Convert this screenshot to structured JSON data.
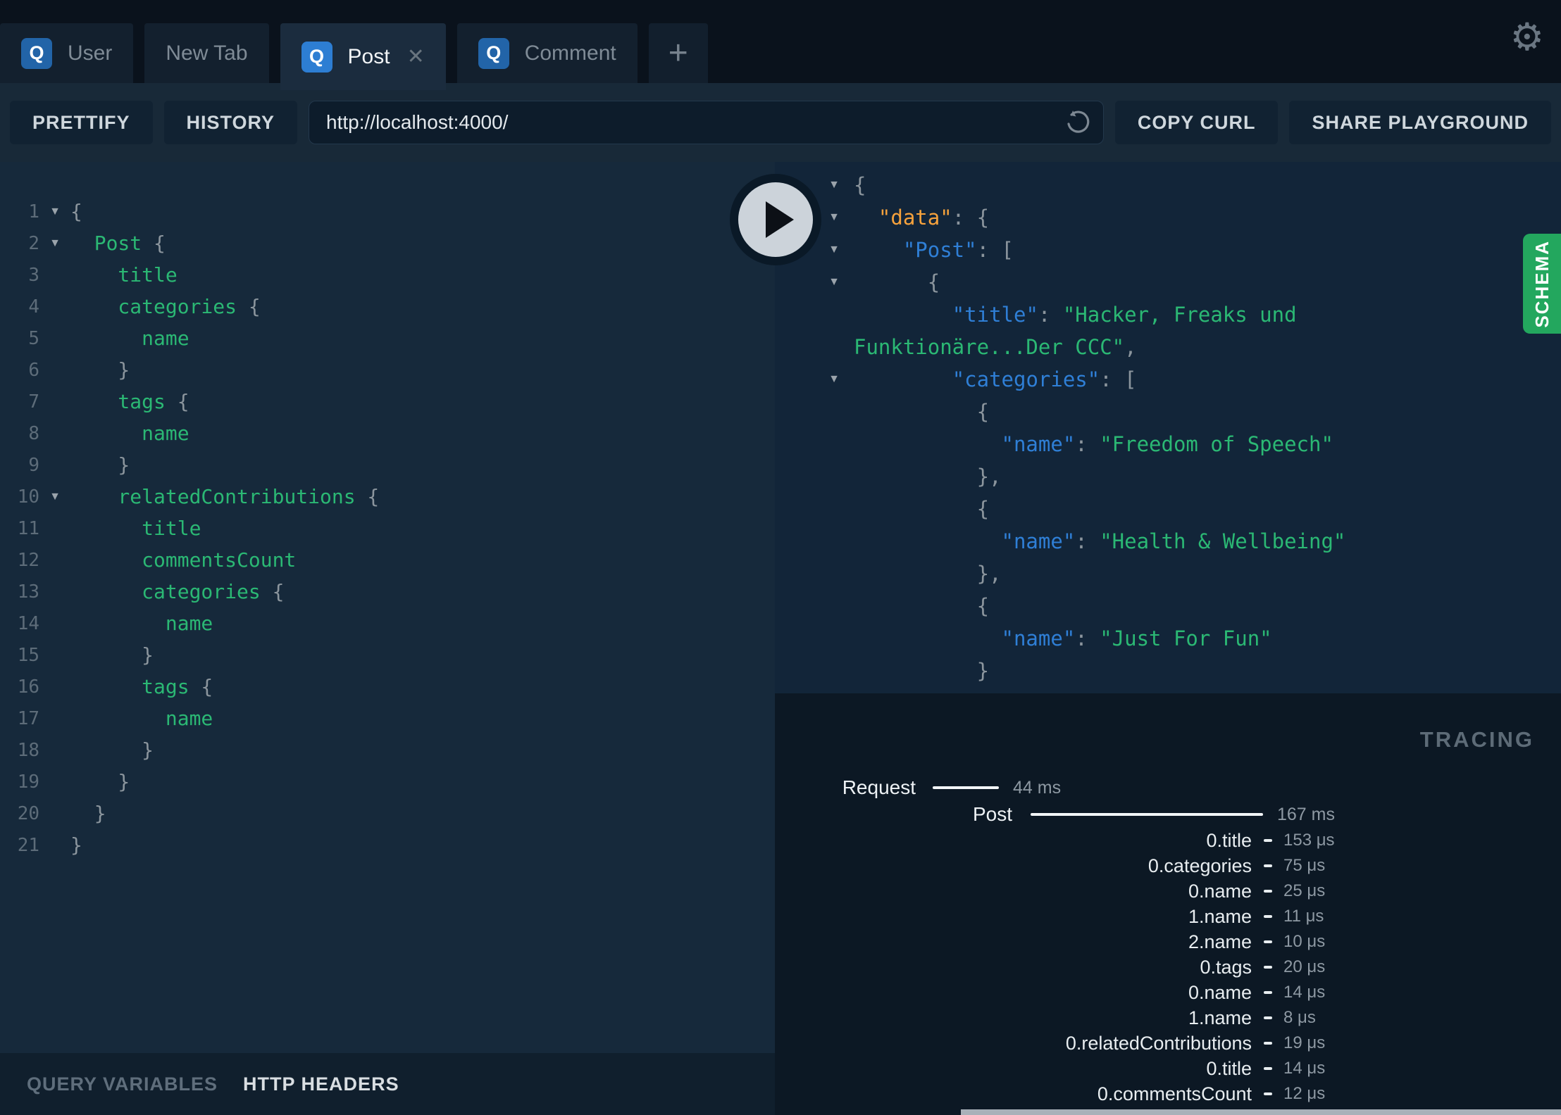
{
  "colors": {
    "badge_blue_active": "#2d7ed3",
    "badge_blue_inactive": "#2264a8",
    "schema_green": "#23a75e",
    "field_green": "#2bb874",
    "key_blue": "#2f7fd6",
    "data_orange": "#f6a23c"
  },
  "icons": {
    "gear": "⚙",
    "close": "✕",
    "plus": "+",
    "fold": "▼",
    "play": "play-triangle",
    "reload": "counterclockwise-arrow"
  },
  "topbar": {
    "tabs": [
      {
        "label": "User",
        "badge": "Q",
        "active": false,
        "closable": false
      },
      {
        "label": "New Tab",
        "badge": "",
        "active": false,
        "closable": false
      },
      {
        "label": "Post",
        "badge": "Q",
        "active": true,
        "closable": true
      },
      {
        "label": "Comment",
        "badge": "Q",
        "active": false,
        "closable": false
      }
    ]
  },
  "toolbar": {
    "prettify_label": "PRETTIFY",
    "history_label": "HISTORY",
    "url": "http://localhost:4000/",
    "copy_curl_label": "COPY CURL",
    "share_label": "SHARE PLAYGROUND"
  },
  "query_editor": {
    "lines": [
      {
        "n": 1,
        "fold": true,
        "parts": [
          [
            "p",
            "{"
          ]
        ]
      },
      {
        "n": 2,
        "fold": true,
        "parts": [
          [
            "f",
            "  Post"
          ],
          [
            "p",
            " {"
          ]
        ]
      },
      {
        "n": 3,
        "fold": false,
        "parts": [
          [
            "f",
            "    title"
          ]
        ]
      },
      {
        "n": 4,
        "fold": false,
        "parts": [
          [
            "f",
            "    categories"
          ],
          [
            "p",
            " {"
          ]
        ]
      },
      {
        "n": 5,
        "fold": false,
        "parts": [
          [
            "f",
            "      name"
          ]
        ]
      },
      {
        "n": 6,
        "fold": false,
        "parts": [
          [
            "p",
            "    }"
          ]
        ]
      },
      {
        "n": 7,
        "fold": false,
        "parts": [
          [
            "f",
            "    tags"
          ],
          [
            "p",
            " {"
          ]
        ]
      },
      {
        "n": 8,
        "fold": false,
        "parts": [
          [
            "f",
            "      name"
          ]
        ]
      },
      {
        "n": 9,
        "fold": false,
        "parts": [
          [
            "p",
            "    }"
          ]
        ]
      },
      {
        "n": 10,
        "fold": true,
        "parts": [
          [
            "f",
            "    relatedContributions"
          ],
          [
            "p",
            " {"
          ]
        ]
      },
      {
        "n": 11,
        "fold": false,
        "parts": [
          [
            "f",
            "      title"
          ]
        ]
      },
      {
        "n": 12,
        "fold": false,
        "parts": [
          [
            "f",
            "      commentsCount"
          ]
        ]
      },
      {
        "n": 13,
        "fold": false,
        "parts": [
          [
            "f",
            "      categories"
          ],
          [
            "p",
            " {"
          ]
        ]
      },
      {
        "n": 14,
        "fold": false,
        "parts": [
          [
            "f",
            "        name"
          ]
        ]
      },
      {
        "n": 15,
        "fold": false,
        "parts": [
          [
            "p",
            "      }"
          ]
        ]
      },
      {
        "n": 16,
        "fold": false,
        "parts": [
          [
            "f",
            "      tags"
          ],
          [
            "p",
            " {"
          ]
        ]
      },
      {
        "n": 17,
        "fold": false,
        "parts": [
          [
            "f",
            "        name"
          ]
        ]
      },
      {
        "n": 18,
        "fold": false,
        "parts": [
          [
            "p",
            "      }"
          ]
        ]
      },
      {
        "n": 19,
        "fold": false,
        "parts": [
          [
            "p",
            "    }"
          ]
        ]
      },
      {
        "n": 20,
        "fold": false,
        "parts": [
          [
            "p",
            "  }"
          ]
        ]
      },
      {
        "n": 21,
        "fold": false,
        "parts": [
          [
            "p",
            "}"
          ]
        ]
      }
    ]
  },
  "response_viewer": {
    "lines": [
      {
        "fold": true,
        "parts": [
          [
            "p",
            "{"
          ]
        ]
      },
      {
        "fold": true,
        "parts": [
          [
            "o",
            "  \"data\""
          ],
          [
            "p",
            ": {"
          ]
        ]
      },
      {
        "fold": true,
        "parts": [
          [
            "k",
            "    \"Post\""
          ],
          [
            "p",
            ": ["
          ]
        ]
      },
      {
        "fold": true,
        "parts": [
          [
            "p",
            "      {"
          ]
        ]
      },
      {
        "fold": false,
        "parts": [
          [
            "k",
            "        \"title\""
          ],
          [
            "p",
            ": "
          ],
          [
            "s",
            "\"Hacker, Freaks und Funktionäre...Der CCC\""
          ],
          [
            "p",
            ","
          ]
        ]
      },
      {
        "fold": true,
        "parts": [
          [
            "k",
            "        \"categories\""
          ],
          [
            "p",
            ": ["
          ]
        ]
      },
      {
        "fold": false,
        "parts": [
          [
            "p",
            "          {"
          ]
        ]
      },
      {
        "fold": false,
        "parts": [
          [
            "k",
            "            \"name\""
          ],
          [
            "p",
            ": "
          ],
          [
            "s",
            "\"Freedom of Speech\""
          ]
        ]
      },
      {
        "fold": false,
        "parts": [
          [
            "p",
            "          },"
          ]
        ]
      },
      {
        "fold": false,
        "parts": [
          [
            "p",
            "          {"
          ]
        ]
      },
      {
        "fold": false,
        "parts": [
          [
            "k",
            "            \"name\""
          ],
          [
            "p",
            ": "
          ],
          [
            "s",
            "\"Health & Wellbeing\""
          ]
        ]
      },
      {
        "fold": false,
        "parts": [
          [
            "p",
            "          },"
          ]
        ]
      },
      {
        "fold": false,
        "parts": [
          [
            "p",
            "          {"
          ]
        ]
      },
      {
        "fold": false,
        "parts": [
          [
            "k",
            "            \"name\""
          ],
          [
            "p",
            ": "
          ],
          [
            "s",
            "\"Just For Fun\""
          ]
        ]
      },
      {
        "fold": false,
        "parts": [
          [
            "p",
            "          }"
          ]
        ]
      },
      {
        "fold": false,
        "parts": [
          [
            "p",
            "        ]"
          ]
        ]
      }
    ]
  },
  "schema_tab": {
    "label": "SCHEMA"
  },
  "tracing": {
    "title": "TRACING",
    "request": {
      "label": "Request",
      "time": "44 ms"
    },
    "root": {
      "label": "Post",
      "time": "167 ms"
    },
    "rows": [
      {
        "label": "0.title",
        "time": "153 μs"
      },
      {
        "label": "0.categories",
        "time": "75 μs"
      },
      {
        "label": "0.name",
        "time": "25 μs"
      },
      {
        "label": "1.name",
        "time": "11 μs"
      },
      {
        "label": "2.name",
        "time": "10 μs"
      },
      {
        "label": "0.tags",
        "time": "20 μs"
      },
      {
        "label": "0.name",
        "time": "14 μs"
      },
      {
        "label": "1.name",
        "time": "8 μs"
      },
      {
        "label": "0.relatedContributions",
        "time": "19 μs"
      },
      {
        "label": "0.title",
        "time": "14 μs"
      },
      {
        "label": "0.commentsCount",
        "time": "12 μs"
      }
    ]
  },
  "left_footer": {
    "query_variables": "QUERY VARIABLES",
    "http_headers": "HTTP HEADERS"
  }
}
